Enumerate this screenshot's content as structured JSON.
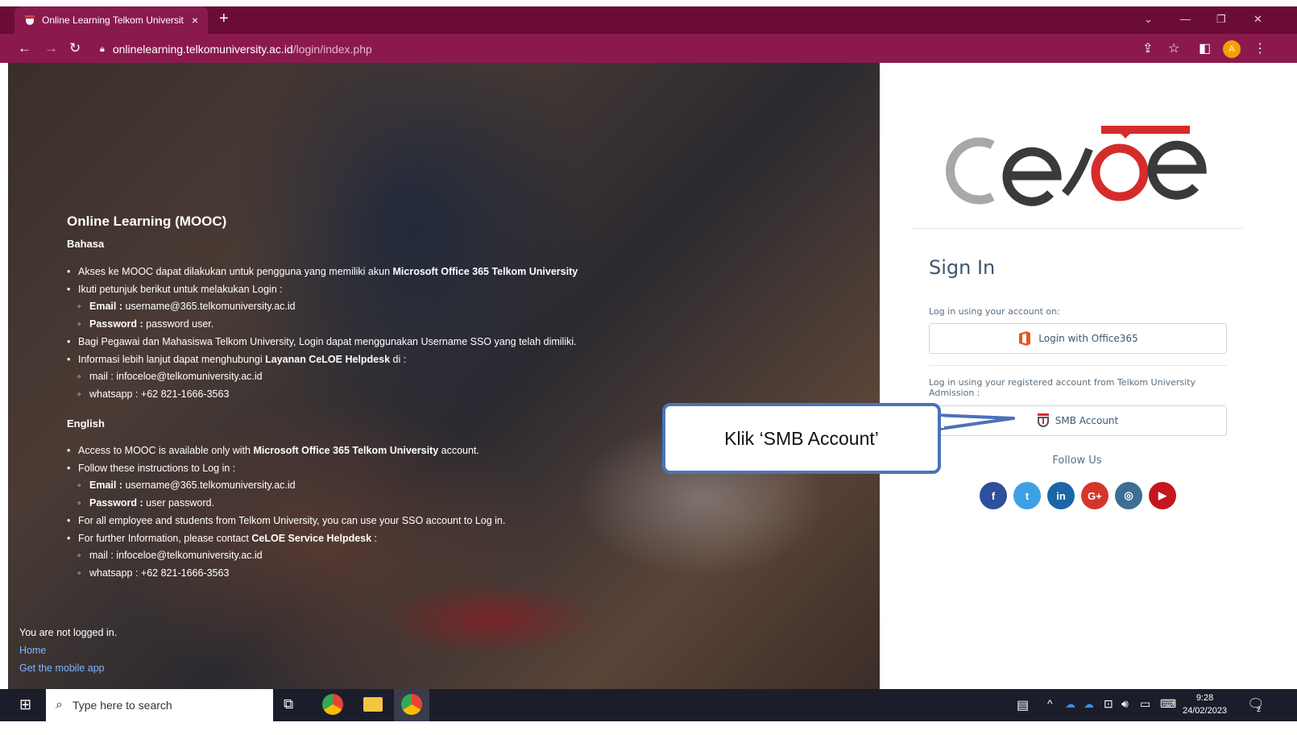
{
  "browser": {
    "tab_title": "Online Learning Telkom Universit",
    "tab_close": "×",
    "new_tab": "+",
    "url_host": "onlinelearning.telkomuniversity.ac.id",
    "url_path": "/login/index.php",
    "avatar_letter": "A"
  },
  "hero": {
    "title": "Online Learning (MOOC)",
    "bahasa_heading": "Bahasa",
    "bahasa_items": [
      {
        "pre": "Akses ke MOOC dapat dilakukan untuk pengguna yang memiliki akun ",
        "bold": "Microsoft Office 365 Telkom University",
        "post": ""
      },
      {
        "pre": "Ikuti petunjuk berikut untuk melakukan Login :",
        "bold": "",
        "post": ""
      },
      {
        "pre": "",
        "bold": "Email :",
        "post": " username@365.telkomuniversity.ac.id",
        "sub": true
      },
      {
        "pre": "",
        "bold": "Password :",
        "post": " password user.",
        "sub": true
      },
      {
        "pre": "Bagi Pegawai dan Mahasiswa Telkom University, Login dapat menggunakan Username SSO yang telah dimiliki.",
        "bold": "",
        "post": ""
      },
      {
        "pre": "Informasi lebih lanjut dapat menghubungi ",
        "bold": "Layanan CeLOE Helpdesk",
        "post": " di :"
      },
      {
        "pre": "mail : infoceloe@telkomuniversity.ac.id",
        "bold": "",
        "post": "",
        "sub": true
      },
      {
        "pre": "whatsapp : +62 821-1666-3563",
        "bold": "",
        "post": "",
        "sub": true
      }
    ],
    "english_heading": "English",
    "english_items": [
      {
        "pre": "Access to MOOC is available only with ",
        "bold": "Microsoft Office 365 Telkom University",
        "post": " account."
      },
      {
        "pre": "Follow these instructions to Log in :",
        "bold": "",
        "post": ""
      },
      {
        "pre": "",
        "bold": "Email :",
        "post": " username@365.telkomuniversity.ac.id",
        "sub": true
      },
      {
        "pre": "",
        "bold": "Password :",
        "post": " user password.",
        "sub": true
      },
      {
        "pre": "For all employee and students from Telkom University, you can use your SSO account to Log in.",
        "bold": "",
        "post": ""
      },
      {
        "pre": "For further Information, please contact ",
        "bold": "CeLOE Service Helpdesk",
        "post": " :"
      },
      {
        "pre": "mail : infoceloe@telkomuniversity.ac.id",
        "bold": "",
        "post": "",
        "sub": true
      },
      {
        "pre": "whatsapp : +62 821-1666-3563",
        "bold": "",
        "post": "",
        "sub": true
      }
    ],
    "not_logged": "You are not logged in.",
    "home_link": "Home",
    "app_link": "Get the mobile app"
  },
  "panel": {
    "sign_in": "Sign In",
    "office_hint": "Log in using your account on:",
    "office_button": "Login with Office365",
    "smb_hint": "Log in using your registered account from Telkom University Admission :",
    "smb_button": "SMB Account",
    "follow_us": "Follow Us",
    "socials": [
      {
        "name": "facebook-icon",
        "glyph": "f",
        "color": "#2d4f9c"
      },
      {
        "name": "twitter-icon",
        "glyph": "t",
        "color": "#3ea0e4"
      },
      {
        "name": "linkedin-icon",
        "glyph": "in",
        "color": "#1a66a8"
      },
      {
        "name": "google-plus-icon",
        "glyph": "G+",
        "color": "#d6362a"
      },
      {
        "name": "instagram-icon",
        "glyph": "◎",
        "color": "#3d6e96"
      },
      {
        "name": "youtube-icon",
        "glyph": "▶",
        "color": "#c4161c"
      }
    ]
  },
  "callout": {
    "text": "Klik ‘SMB Account’"
  },
  "taskbar": {
    "search_placeholder": "Type here to search",
    "time": "9:28",
    "date": "24/02/2023",
    "notification_count": "2"
  },
  "colors": {
    "browser_frame": "#6b0c37",
    "callout_border": "#4a72b6",
    "accent_red": "#d62b2b"
  }
}
